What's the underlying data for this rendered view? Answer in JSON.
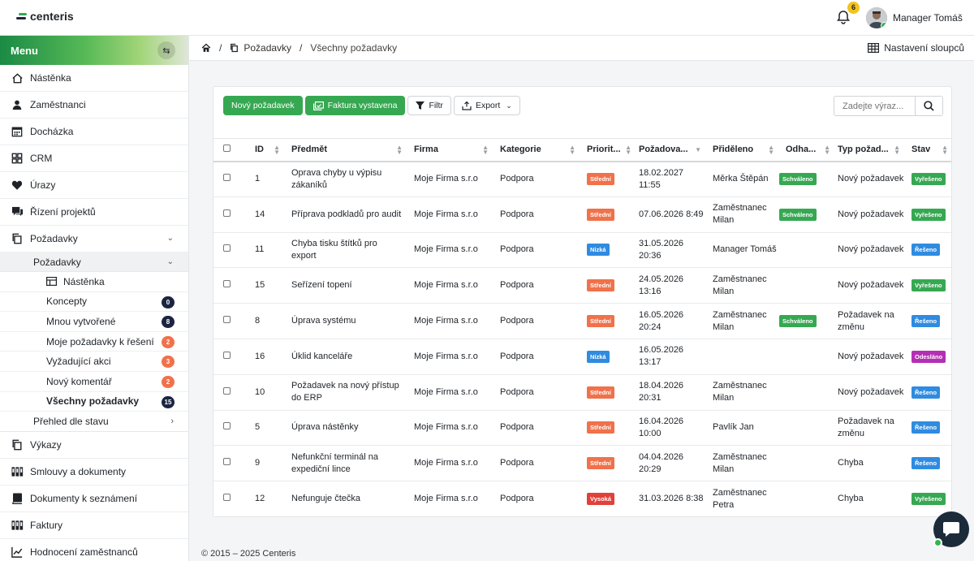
{
  "app": {
    "logo_text": "centeris",
    "brand_color": "#36a852"
  },
  "header": {
    "notifications_count": "6",
    "user_name": "Manager Tomáš"
  },
  "sidebar": {
    "menu_label": "Menu",
    "toggle_icon": "swap-arrows-icon",
    "items_top": [
      {
        "label": "Nástěnka",
        "icon": "home-icon"
      },
      {
        "label": "Zaměstnanci",
        "icon": "user-icon"
      },
      {
        "label": "Docházka",
        "icon": "calendar-icon"
      },
      {
        "label": "CRM",
        "icon": "grid-icon"
      },
      {
        "label": "Úrazy",
        "icon": "heart-icon"
      },
      {
        "label": "Řízení projektů",
        "icon": "chat-icon"
      },
      {
        "label": "Požadavky",
        "icon": "copy-icon"
      }
    ],
    "subgroup": {
      "label": "Požadavky",
      "items": [
        {
          "label": "Nástěnka",
          "count": "",
          "color": ""
        },
        {
          "label": "Koncepty",
          "count": "0",
          "color": "#1c2540"
        },
        {
          "label": "Mnou vytvořené",
          "count": "8",
          "color": "#1c2540"
        },
        {
          "label": "Moje požadavky k řešení",
          "count": "2",
          "color": "#f0714a"
        },
        {
          "label": "Vyžadující akci",
          "count": "3",
          "color": "#f0714a"
        },
        {
          "label": "Nový komentář",
          "count": "2",
          "color": "#f0714a"
        },
        {
          "label": "Všechny požadavky",
          "count": "15",
          "color": "#1c2540"
        }
      ],
      "overview_label": "Přehled dle stavu"
    },
    "items_bottom": [
      {
        "label": "Výkazy",
        "icon": "copy-icon"
      },
      {
        "label": "Smlouvy a dokumenty",
        "icon": "books-icon"
      },
      {
        "label": "Dokumenty k seznámení",
        "icon": "book-icon"
      },
      {
        "label": "Faktury",
        "icon": "books-icon"
      },
      {
        "label": "Hodnocení zaměstnanců",
        "icon": "chart-icon"
      }
    ]
  },
  "breadcrumb": {
    "section": "Požadavky",
    "page": "Všechny požadavky",
    "columns_settings": "Nastavení sloupců"
  },
  "toolbar": {
    "new_request": "Nový požadavek",
    "invoice_issued": "Faktura vystavena",
    "filter": "Filtr",
    "export": "Export",
    "search_placeholder": "Zadejte výraz..."
  },
  "table": {
    "headers": [
      "ID",
      "Předmět",
      "Firma",
      "Kategorie",
      "Priorit...",
      "Požadova...",
      "Přiděleno",
      "Odha...",
      "Typ požad...",
      "Stav"
    ],
    "rows": [
      {
        "id": "1",
        "subject": "Oprava chyby u výpisu zákaníků",
        "company": "Moje Firma s.r.o",
        "category": "Podpora",
        "priority": "Střední",
        "priority_color": "#f0714a",
        "date": "18.02.2027 11:55",
        "assigned": "Měrka Štěpán",
        "estimate": "Schváleno",
        "type": "Nový požadavek",
        "status": "Vyřešeno",
        "status_color": "#36a852"
      },
      {
        "id": "14",
        "subject": "Příprava podkladů pro audit",
        "company": "Moje Firma s.r.o",
        "category": "Podpora",
        "priority": "Střední",
        "priority_color": "#f0714a",
        "date": "07.06.2026 8:49",
        "assigned": "Zaměstnanec Milan",
        "estimate": "Schváleno",
        "type": "Nový požadavek",
        "status": "Vyřešeno",
        "status_color": "#36a852"
      },
      {
        "id": "11",
        "subject": "Chyba tisku štítků pro export",
        "company": "Moje Firma s.r.o",
        "category": "Podpora",
        "priority": "Nízká",
        "priority_color": "#2f8be0",
        "date": "31.05.2026 20:36",
        "assigned": "Manager Tomáš",
        "estimate": "",
        "type": "Nový požadavek",
        "status": "Řešeno",
        "status_color": "#2f8be0"
      },
      {
        "id": "15",
        "subject": "Seřízení topení",
        "company": "Moje Firma s.r.o",
        "category": "Podpora",
        "priority": "Střední",
        "priority_color": "#f0714a",
        "date": "24.05.2026 13:16",
        "assigned": "Zaměstnanec Milan",
        "estimate": "",
        "type": "Nový požadavek",
        "status": "Vyřešeno",
        "status_color": "#36a852"
      },
      {
        "id": "8",
        "subject": "Úprava systému",
        "company": "Moje Firma s.r.o",
        "category": "Podpora",
        "priority": "Střední",
        "priority_color": "#f0714a",
        "date": "16.05.2026 20:24",
        "assigned": "Zaměstnanec Milan",
        "estimate": "Schváleno",
        "type": "Požadavek na změnu",
        "status": "Řešeno",
        "status_color": "#2f8be0"
      },
      {
        "id": "16",
        "subject": "Úklid kanceláře",
        "company": "Moje Firma s.r.o",
        "category": "Podpora",
        "priority": "Nízká",
        "priority_color": "#2f8be0",
        "date": "16.05.2026 13:17",
        "assigned": "",
        "estimate": "",
        "type": "Nový požadavek",
        "status": "Odesláno",
        "status_color": "#b52fb5"
      },
      {
        "id": "10",
        "subject": "Požadavek na nový přístup do ERP",
        "company": "Moje Firma s.r.o",
        "category": "Podpora",
        "priority": "Střední",
        "priority_color": "#f0714a",
        "date": "18.04.2026 20:31",
        "assigned": "Zaměstnanec Milan",
        "estimate": "",
        "type": "Nový požadavek",
        "status": "Řešeno",
        "status_color": "#2f8be0"
      },
      {
        "id": "5",
        "subject": "Úprava nástěnky",
        "company": "Moje Firma s.r.o",
        "category": "Podpora",
        "priority": "Střední",
        "priority_color": "#f0714a",
        "date": "16.04.2026 10:00",
        "assigned": "Pavlík Jan",
        "estimate": "",
        "type": "Požadavek na změnu",
        "status": "Řešeno",
        "status_color": "#2f8be0"
      },
      {
        "id": "9",
        "subject": "Nefunkční terminál na expediční lince",
        "company": "Moje Firma s.r.o",
        "category": "Podpora",
        "priority": "Střední",
        "priority_color": "#f0714a",
        "date": "04.04.2026 20:29",
        "assigned": "Zaměstnanec Milan",
        "estimate": "",
        "type": "Chyba",
        "status": "Řešeno",
        "status_color": "#2f8be0"
      },
      {
        "id": "12",
        "subject": "Nefunguje čtečka",
        "company": "Moje Firma s.r.o",
        "category": "Podpora",
        "priority": "Vysoká",
        "priority_color": "#e0413a",
        "date": "31.03.2026 8:38",
        "assigned": "Zaměstnanec Petra",
        "estimate": "",
        "type": "Chyba",
        "status": "Vyřešeno",
        "status_color": "#36a852"
      }
    ]
  },
  "footer": {
    "copyright": "© 2015 – 2025 Centeris"
  }
}
